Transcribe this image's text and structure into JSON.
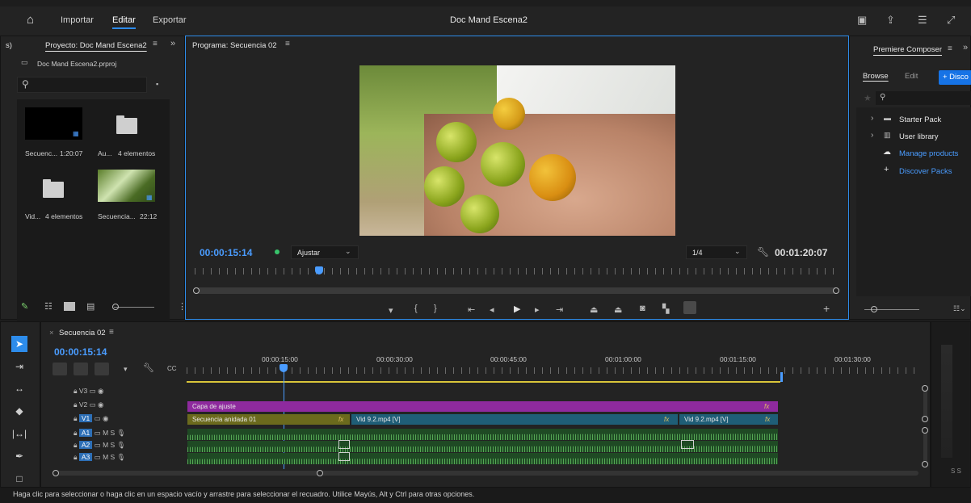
{
  "menu": {
    "importar": "Importar",
    "editar": "Editar",
    "exportar": "Exportar",
    "title": "Doc Mand Escena2"
  },
  "project": {
    "left_fragment": "s)",
    "tab": "Proyecto: Doc Mand Escena2",
    "file": "Doc Mand Escena2.prproj",
    "items": [
      {
        "name": "Secuenc...",
        "meta": "1:20:07"
      },
      {
        "name": "Au...",
        "meta": "4 elementos"
      },
      {
        "name": "Vid...",
        "meta": "4 elementos"
      },
      {
        "name": "Secuencia...",
        "meta": "22:12"
      }
    ]
  },
  "program": {
    "tab": "Programa: Secuencia 02",
    "timecode": "00:00:15:14",
    "fit": "Ajustar",
    "quality": "1/4",
    "duration": "00:01:20:07"
  },
  "composer": {
    "tab": "Premiere Composer",
    "browse": "Browse",
    "edit": "Edit",
    "discover_btn": "+ Disco",
    "items": [
      "Starter Pack",
      "User library",
      "Manage products",
      "Discover Packs"
    ]
  },
  "timeline": {
    "tab": "Secuencia 02",
    "timecode": "00:00:15:14",
    "ruler": [
      "00:00:15:00",
      "00:00:30:00",
      "00:00:45:00",
      "00:01:00:00",
      "00:01:15:00",
      "00:01:30:00"
    ],
    "tracks_video": [
      "V3",
      "V2",
      "V1"
    ],
    "tracks_audio": [
      "A1",
      "A2",
      "A3"
    ],
    "clips": {
      "adjust": "Capa de ajuste",
      "nested": "Secuencia anidada 01",
      "vid1": "Vid 9.2.mp4 [V]",
      "vid2": "Vid 9.2.mp4 [V]"
    },
    "fx": "fx",
    "m": "M",
    "s": "S",
    "meter_label": "S S"
  },
  "status": "Haga clic para seleccionar o haga clic en un espacio vacío y arrastre para seleccionar el recuadro. Utilice Mayús, Alt y Ctrl para otras opciones.",
  "colors": {
    "accent": "#4a9cff",
    "adjust": "#8e2a9e",
    "nested": "#6b6a1d",
    "vid": "#1f5e77",
    "audio": "#1f4a24"
  }
}
